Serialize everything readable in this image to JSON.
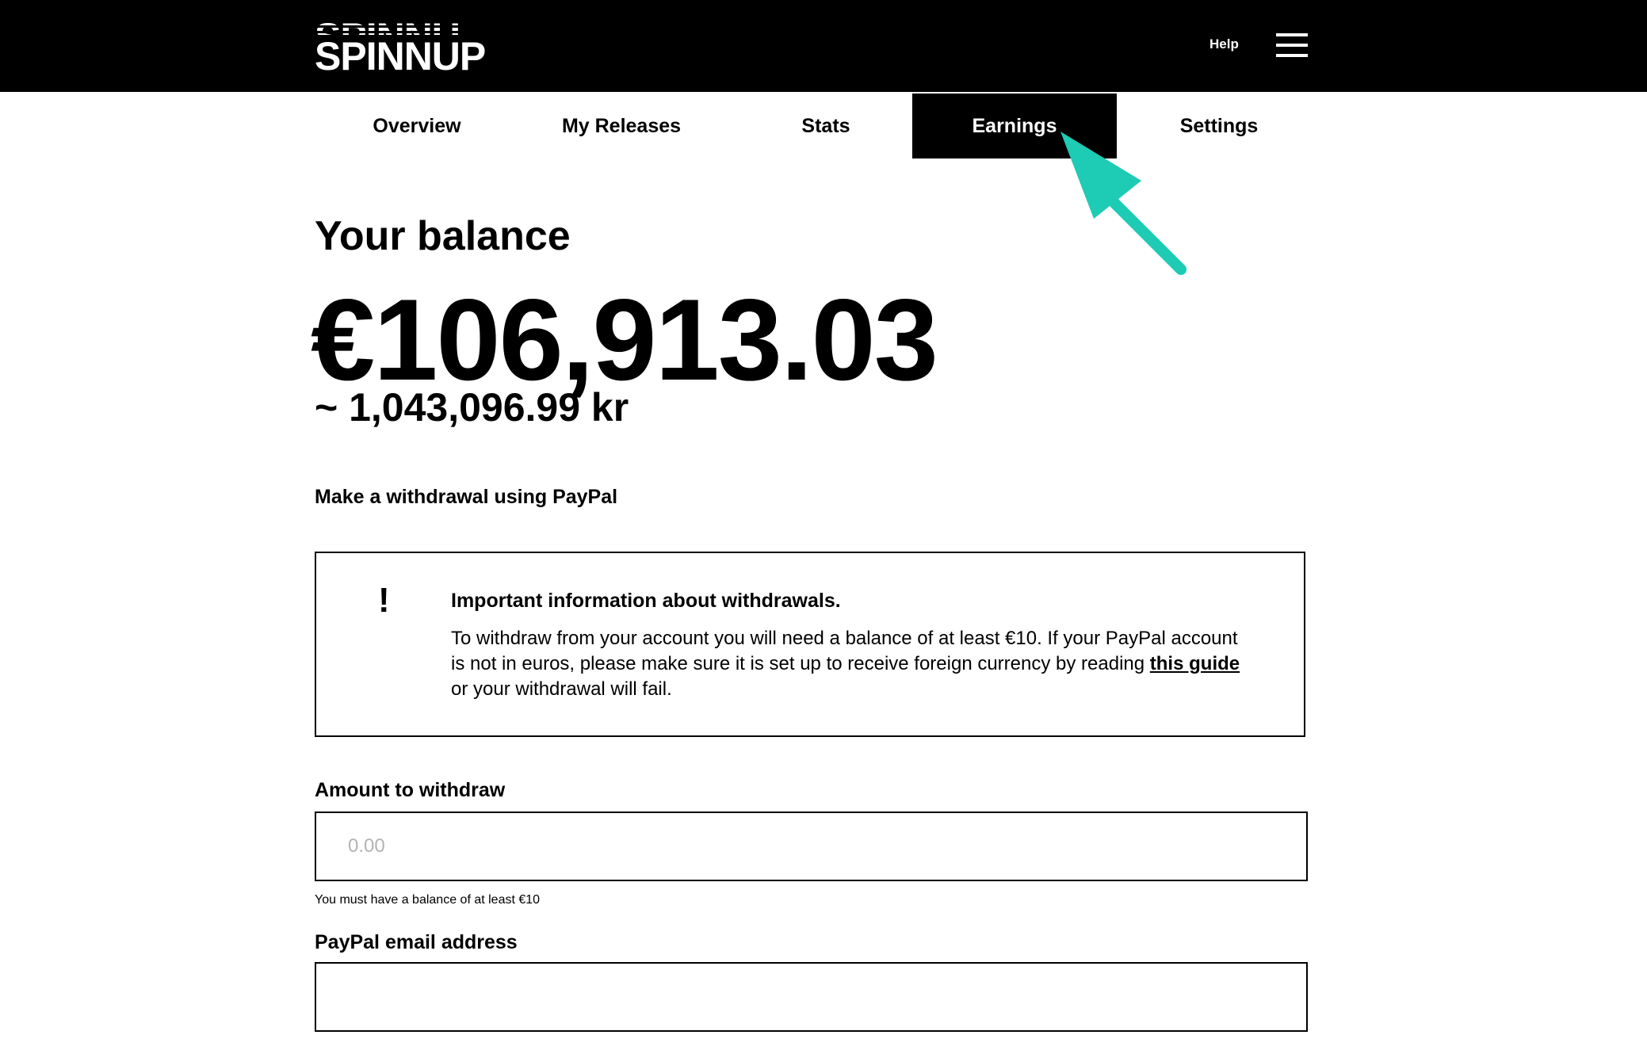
{
  "header": {
    "logo_text": "SPINNUP",
    "help_label": "Help",
    "menu_icon": "hamburger-menu-icon"
  },
  "tabs": [
    {
      "label": "Overview",
      "active": false
    },
    {
      "label": "My Releases",
      "active": false
    },
    {
      "label": "Stats",
      "active": false
    },
    {
      "label": "Earnings",
      "active": true
    },
    {
      "label": "Settings",
      "active": false
    }
  ],
  "annotation": {
    "icon": "arrow-pointer-icon",
    "color": "#1ecbb4"
  },
  "balance": {
    "heading": "Your balance",
    "amount_eur": "€106,913.03",
    "amount_local": "~ 1,043,096.99 kr"
  },
  "withdrawal": {
    "heading": "Make a withdrawal using PayPal",
    "info": {
      "icon": "exclamation-icon",
      "icon_glyph": "!",
      "title": "Important information about withdrawals.",
      "body_before": "To withdraw from your account you will need a balance of at least €10. If your PayPal account is not in euros, please make sure it is set up to receive foreign currency by reading ",
      "link_text": "this guide",
      "body_after": " or your withdrawal will fail."
    },
    "amount_label": "Amount to withdraw",
    "amount_placeholder": "0.00",
    "amount_value": "",
    "amount_hint": "You must have a balance of at least €10",
    "email_label": "PayPal email address",
    "email_value": ""
  },
  "colors": {
    "topbar": "#000000",
    "accent": "#1ecbb4",
    "text": "#000000",
    "placeholder": "#b3b3b3"
  }
}
